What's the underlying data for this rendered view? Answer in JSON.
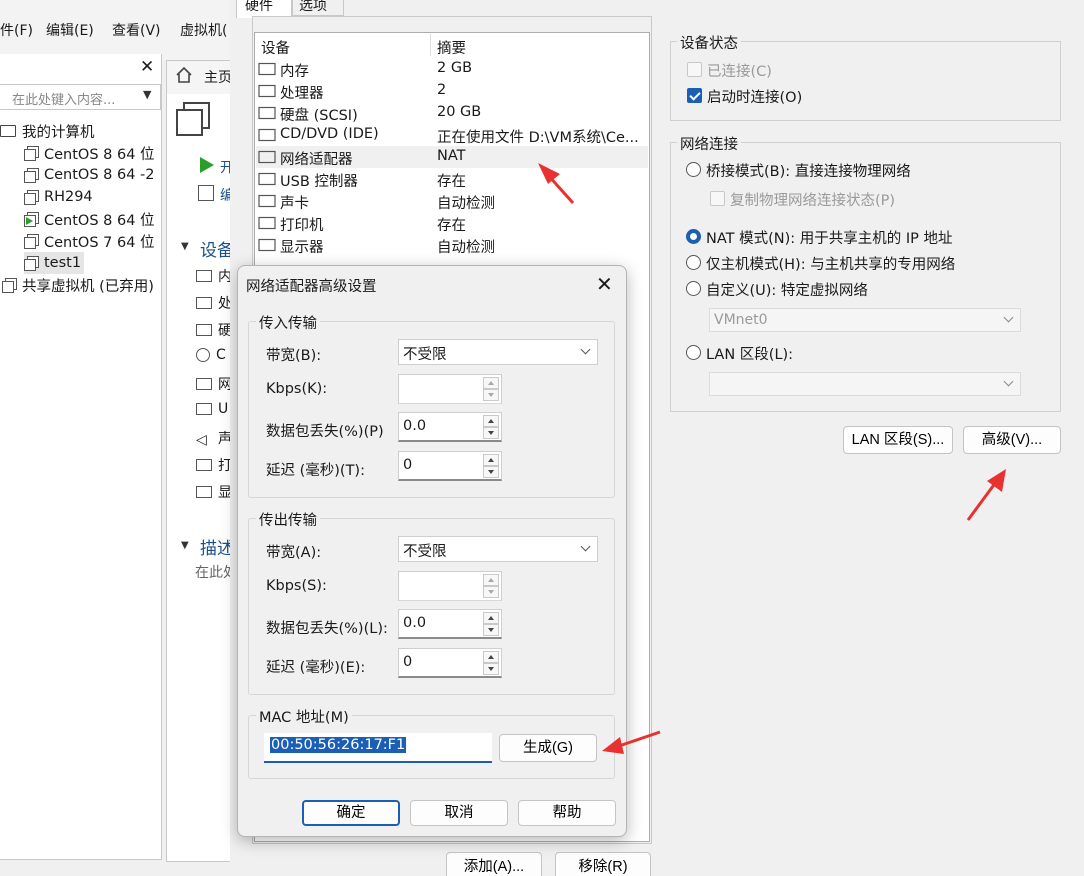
{
  "menubar": {
    "file": "件(F)",
    "edit": "编辑(E)",
    "view": "查看(V)",
    "vm": "虚拟机("
  },
  "library": {
    "search_placeholder": "在此处键入内容...",
    "root": "我的计算机",
    "vms": [
      "CentOS 8 64 位",
      "CentOS 8 64 -2",
      "RH294",
      "CentOS 8 64 位",
      "CentOS 7 64 位",
      "test1"
    ],
    "shared": "共享虚拟机 (已弃用)"
  },
  "home_tab": {
    "label": "主页"
  },
  "vm_page": {
    "power_on": "开",
    "edit": "编",
    "devices_section": "设备",
    "device_stubs": [
      "内",
      "处",
      "硬",
      "C",
      "网",
      "U",
      "声",
      "打",
      "显"
    ],
    "description_section": "描述",
    "description_hint": "在此处"
  },
  "settings": {
    "tabs": [
      "硬件",
      "选项"
    ],
    "list_headers": {
      "device": "设备",
      "summary": "摘要"
    },
    "devices": [
      {
        "icon": "memory-icon",
        "name": "内存",
        "summary": "2 GB"
      },
      {
        "icon": "cpu-icon",
        "name": "处理器",
        "summary": "2"
      },
      {
        "icon": "disk-icon",
        "name": "硬盘 (SCSI)",
        "summary": "20 GB"
      },
      {
        "icon": "cd-icon",
        "name": "CD/DVD (IDE)",
        "summary": "正在使用文件 D:\\VM系统\\Ce..."
      },
      {
        "icon": "network-icon",
        "name": "网络适配器",
        "summary": "NAT"
      },
      {
        "icon": "usb-icon",
        "name": "USB 控制器",
        "summary": "存在"
      },
      {
        "icon": "speaker-icon",
        "name": "声卡",
        "summary": "自动检测"
      },
      {
        "icon": "printer-icon",
        "name": "打印机",
        "summary": "存在"
      },
      {
        "icon": "display-icon",
        "name": "显示器",
        "summary": "自动检测"
      }
    ],
    "selected_device_index": 4,
    "add_button": "添加(A)...",
    "remove_button": "移除(R)",
    "device_status": {
      "title": "设备状态",
      "connected": "已连接(C)",
      "connect_at_power_on": "启动时连接(O)"
    },
    "network_connection": {
      "title": "网络连接",
      "bridged": "桥接模式(B): 直接连接物理网络",
      "replicate": "复制物理网络连接状态(P)",
      "nat": "NAT 模式(N): 用于共享主机的 IP 地址",
      "host_only": "仅主机模式(H): 与主机共享的专用网络",
      "custom": "自定义(U): 特定虚拟网络",
      "custom_value": "VMnet0",
      "lan_segment": "LAN 区段(L):",
      "lan_value": ""
    },
    "lan_segments_button": "LAN 区段(S)...",
    "advanced_button": "高级(V)..."
  },
  "dialog": {
    "title": "网络适配器高级设置",
    "incoming": {
      "title": "传入传输",
      "bandwidth_label": "带宽(B):",
      "bandwidth_value": "不受限",
      "kbps_label": "Kbps(K):",
      "kbps_value": "",
      "loss_label": "数据包丢失(%)(P)",
      "loss_value": "0.0",
      "latency_label": "延迟 (毫秒)(T):",
      "latency_value": "0"
    },
    "outgoing": {
      "title": "传出传输",
      "bandwidth_label": "带宽(A):",
      "bandwidth_value": "不受限",
      "kbps_label": "Kbps(S):",
      "kbps_value": "",
      "loss_label": "数据包丢失(%)(L):",
      "loss_value": "0.0",
      "latency_label": "延迟 (毫秒)(E):",
      "latency_value": "0"
    },
    "mac": {
      "title": "MAC 地址(M)",
      "value": "00:50:56:26:17:F1",
      "generate": "生成(G)"
    },
    "buttons": {
      "ok": "确定",
      "cancel": "取消",
      "help": "帮助"
    }
  },
  "colors": {
    "accent": "#1a5fb4",
    "annotation_arrow": "#e8322f",
    "link_blue": "#1b4f8a"
  }
}
